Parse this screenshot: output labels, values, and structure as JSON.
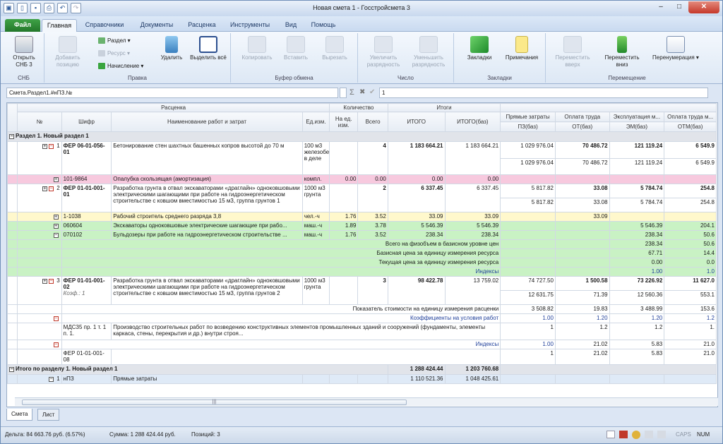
{
  "window": {
    "title": "Новая смета 1 - Госстройсмета 3"
  },
  "tabs": [
    "Файл",
    "Главная",
    "Справочники",
    "Документы",
    "Расценка",
    "Инструменты",
    "Вид",
    "Помощь"
  ],
  "ribbon": {
    "snb": {
      "open": "Открыть СНБ 3",
      "group": "СНБ"
    },
    "pravka": {
      "add": "Добавить позицию",
      "razdel": "Раздел",
      "resurs": "Ресурс",
      "nachislenie": "Начисление",
      "delete": "Удалить",
      "select_all": "Выделить всё",
      "group": "Правка"
    },
    "buffer": {
      "copy": "Копировать",
      "paste": "Вставить",
      "cut": "Вырезать",
      "group": "Буфер обмена"
    },
    "chislo": {
      "inc": "Увеличить разрядность",
      "dec": "Уменьшить разрядность",
      "group": "Число"
    },
    "zakladki": {
      "bookmarks": "Закладки",
      "notes": "Примечания",
      "group": "Закладки"
    },
    "move": {
      "up": "Переместить вверх",
      "down": "Переместить вниз",
      "renumber": "Перенумерация",
      "group": "Перемещение"
    }
  },
  "formula": {
    "path": "Смета.Раздел1.#нПЗ.№",
    "value": "1"
  },
  "header": {
    "rascenka": "Расценка",
    "kolichestvo": "Количество",
    "itogi": "Итоги",
    "num": "№",
    "shifr": "Шифр",
    "name": "Наименование работ и затрат",
    "ed": "Ед.изм.",
    "na_ed": "На ед. изм.",
    "vsego": "Всего",
    "itogo": "ИТОГО",
    "itogo_baz": "ИТОГО(баз)",
    "pz": "Прямые затраты",
    "ot": "Оплата труда",
    "em": "Эксплуатация м...",
    "otm": "Оплата труда м...",
    "pz_baz": "ПЗ(баз)",
    "ot_baz": "ОТ(баз)",
    "em_baz": "ЭМ(баз)",
    "otm_baz": "ОТМ(баз)"
  },
  "rows": {
    "sec1": "Раздел 1. Новый раздел 1",
    "p1": {
      "n": "1",
      "code": "ФЕР 06-01-056-01",
      "name": "Бетонирование стен шахтных башенных копров высотой до 70 м",
      "ed": "100 м3 железобетона в деле",
      "vsego": "4",
      "itogo": "1 183 664.21",
      "itogo_baz": "1 183 664.21",
      "pz": "1 029 976.04",
      "ot": "70 486.72",
      "em": "121 119.24",
      "otm": "6 549.9",
      "pz2": "1 029 976.04",
      "ot2": "70 486.72",
      "em2": "121 119.24",
      "otm2": "6 549.9"
    },
    "r1": {
      "code": "101-9864",
      "name": "Опалубка скользящая (амортизация)",
      "ed": "компл.",
      "na": "0.00",
      "vsego": "0.00",
      "itogo": "0.00",
      "baz": "0.00"
    },
    "p2": {
      "n": "2",
      "code": "ФЕР 01-01-001-01",
      "name": "Разработка грунта в отвал экскаваторами «драглайн» одноковшовыми электрическими шагающими при работе на гидроэнергетическом строительстве с ковшом вместимостью 15 м3, группа грунтов 1",
      "ed": "1000 м3 грунта",
      "vsego": "2",
      "itogo": "6 337.45",
      "itogo_baz": "6 337.45",
      "pz": "5 817.82",
      "ot": "33.08",
      "em": "5 784.74",
      "otm": "254.8",
      "pz2": "5 817.82",
      "ot2": "33.08",
      "em2": "5 784.74",
      "otm2": "254.8"
    },
    "r2": {
      "code": "1-1038",
      "name": "Рабочий строитель среднего разряда 3,8",
      "ed": "чел.-ч",
      "na": "1.76",
      "vsego": "3.52",
      "itogo": "33.09",
      "baz": "33.09",
      "ot": "33.09"
    },
    "r3": {
      "code": "060604",
      "name": "Экскаваторы одноковшовые электрические шагающие при рабо...",
      "ed": "маш.-ч",
      "na": "1.89",
      "vsego": "3.78",
      "itogo": "5 546.39",
      "baz": "5 546.39",
      "em": "5 546.39",
      "otm": "204.1"
    },
    "r4": {
      "code": "070102",
      "name": "Бульдозеры при работе на гидроэнергетическом строительстве ...",
      "ed": "маш.-ч",
      "na": "1.76",
      "vsego": "3.52",
      "itogo": "238.34",
      "baz": "238.34",
      "em": "238.34",
      "otm": "50.6"
    },
    "g1": {
      "label": "Всего на физобъем в базисном уровне цен",
      "em": "238.34",
      "otm": "50.6"
    },
    "g2": {
      "label": "Базисная цена за единицу измерения ресурса",
      "em": "67.71",
      "otm": "14.4"
    },
    "g3": {
      "label": "Текущая цена за единицу измерения ресурса",
      "em": "0.00",
      "otm": "0.0"
    },
    "g4": {
      "label": "Индексы",
      "em": "1.00",
      "otm": "1.0"
    },
    "p3": {
      "n": "3",
      "code": "ФЕР 01-01-001-02",
      "koef": "Коэф.: 1",
      "name": "Разработка грунта в отвал экскаваторами «драглайн» одноковшовыми электрическими шагающими при работе на гидроэнергетическом строительстве с ковшом вместимостью 15 м3, группа грунтов 2",
      "ed": "1000 м3 грунта",
      "vsego": "3",
      "itogo": "98 422.78",
      "itogo_baz": "13 759.02",
      "pz": "74 727.50",
      "ot": "1 500.58",
      "em": "73 226.92",
      "otm": "11 627.0",
      "pz2": "12 631.75",
      "ot2": "71.39",
      "em2": "12 560.36",
      "otm2": "553.1"
    },
    "p3a": {
      "label": "Показатель стоимости на единицу измерения расценки",
      "pz": "3 508.82",
      "ot": "19.83",
      "em": "3 488.99",
      "otm": "153.6"
    },
    "p3b": {
      "label": "Коэффициенты на условия работ",
      "pz": "1.00",
      "ot": "1.20",
      "em": "1.20",
      "otm": "1.2"
    },
    "p3c": {
      "code": "МДС35 пр. 1 т. 1 п. 1.",
      "name": "Производство строительных работ по возведению конструктивных элементов промышленных зданий и сооружений (фундаменты, элементы каркаса, стены, перекрытия и др.) внутри строя...",
      "pz": "1",
      "ot": "1.2",
      "em": "1.2",
      "otm": "1."
    },
    "p3d": {
      "label": "Индексы",
      "itogo_baz": "1.00",
      "ot": "21.02",
      "em": "5.83",
      "otm": "21.0"
    },
    "p3e": {
      "code": "ФЕР 01-01-001-08",
      "itogo_baz": "1",
      "ot": "21.02",
      "em": "5.83",
      "otm": "21.0"
    },
    "tot": {
      "label": "Итого по разделу 1. Новый раздел 1",
      "itogo": "1 288 424.44",
      "baz": "1 203 760.68"
    },
    "last": {
      "n": "1",
      "code": "нПЗ",
      "name": "Прямые затраты",
      "itogo": "1 110 521.36",
      "baz": "1 048 425.61"
    }
  },
  "sheet_tabs": [
    "Смета",
    "Лист"
  ],
  "status": {
    "delta": "Дельта: 84 663.76 руб. (6.57%)",
    "sum": "Сумма: 1 288 424.44 руб.",
    "pos": "Позиций:  3",
    "caps": "CAPS",
    "num": "NUM"
  }
}
